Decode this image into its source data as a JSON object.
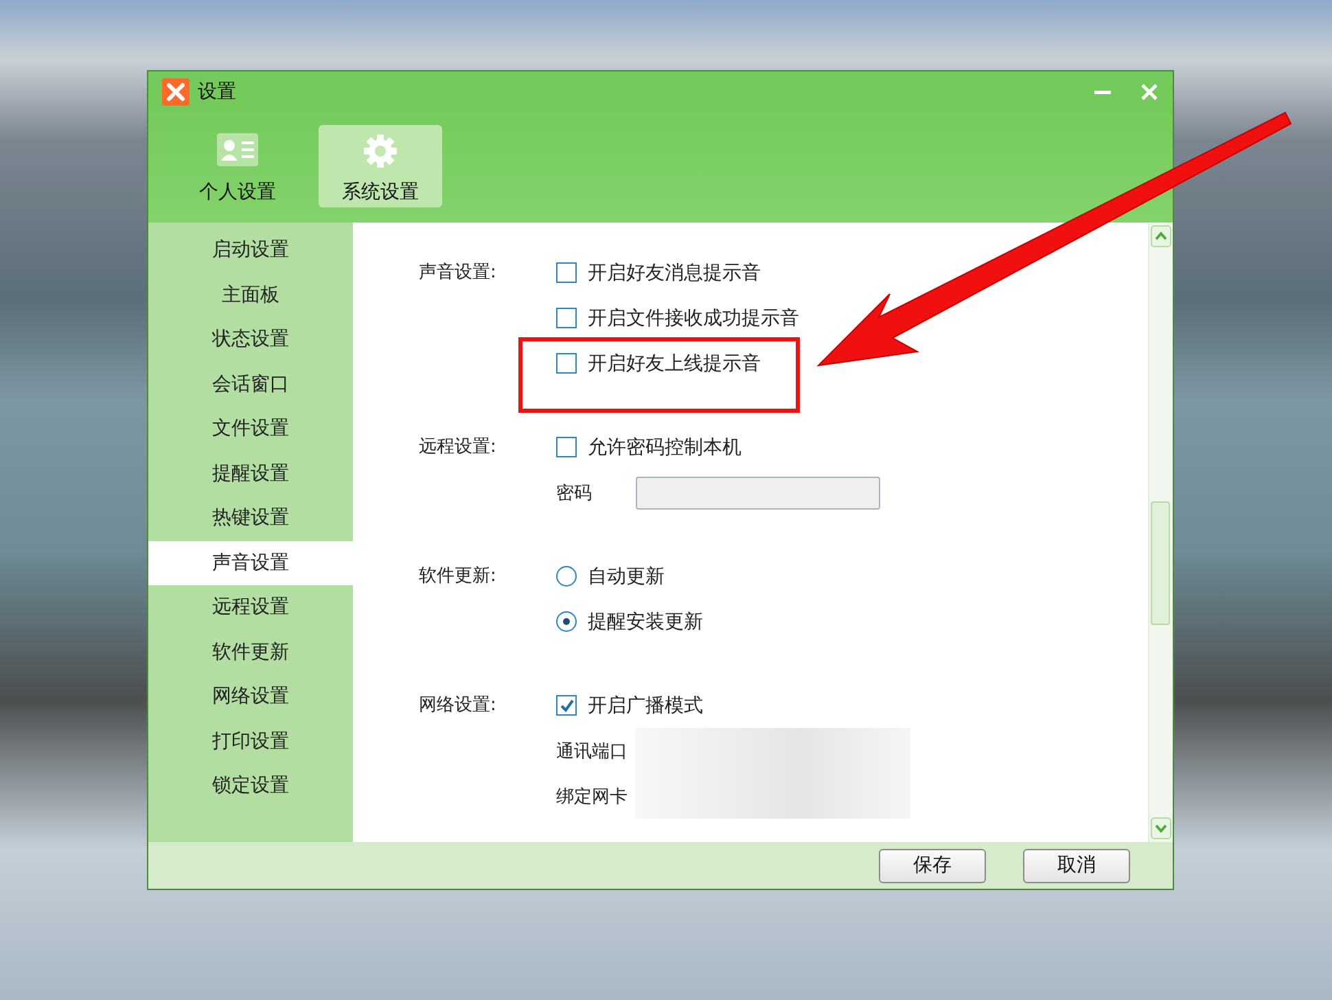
{
  "window": {
    "title": "设置"
  },
  "tabs": [
    {
      "label": "个人设置",
      "kind": "profile",
      "selected": false
    },
    {
      "label": "系统设置",
      "kind": "gear",
      "selected": true
    }
  ],
  "sidebar": {
    "items": [
      {
        "label": "启动设置",
        "selected": false
      },
      {
        "label": "主面板",
        "selected": false
      },
      {
        "label": "状态设置",
        "selected": false
      },
      {
        "label": "会话窗口",
        "selected": false
      },
      {
        "label": "文件设置",
        "selected": false
      },
      {
        "label": "提醒设置",
        "selected": false
      },
      {
        "label": "热键设置",
        "selected": false
      },
      {
        "label": "声音设置",
        "selected": true
      },
      {
        "label": "远程设置",
        "selected": false
      },
      {
        "label": "软件更新",
        "selected": false
      },
      {
        "label": "网络设置",
        "selected": false
      },
      {
        "label": "打印设置",
        "selected": false
      },
      {
        "label": "锁定设置",
        "selected": false
      }
    ]
  },
  "sections": [
    {
      "label": "声音设置:",
      "options": [
        {
          "kind": "checkbox",
          "label": "开启好友消息提示音",
          "checked": false
        },
        {
          "kind": "checkbox",
          "label": "开启文件接收成功提示音",
          "checked": false
        },
        {
          "kind": "checkbox",
          "label": "开启好友上线提示音",
          "checked": false
        }
      ]
    },
    {
      "label": "远程设置:",
      "options": [
        {
          "kind": "checkbox",
          "label": "允许密码控制本机",
          "checked": false
        },
        {
          "kind": "field",
          "label": "密码"
        }
      ]
    },
    {
      "label": "软件更新:",
      "options": [
        {
          "kind": "radio",
          "label": "自动更新",
          "selected": false
        },
        {
          "kind": "radio",
          "label": "提醒安装更新",
          "selected": true
        }
      ]
    },
    {
      "label": "网络设置:",
      "options": [
        {
          "kind": "checkbox",
          "label": "开启广播模式",
          "checked": true
        },
        {
          "kind": "redacted",
          "label": "通讯端口"
        },
        {
          "kind": "redacted",
          "label": "绑定网卡"
        }
      ]
    }
  ],
  "buttons": [
    "保存",
    "取消"
  ]
}
